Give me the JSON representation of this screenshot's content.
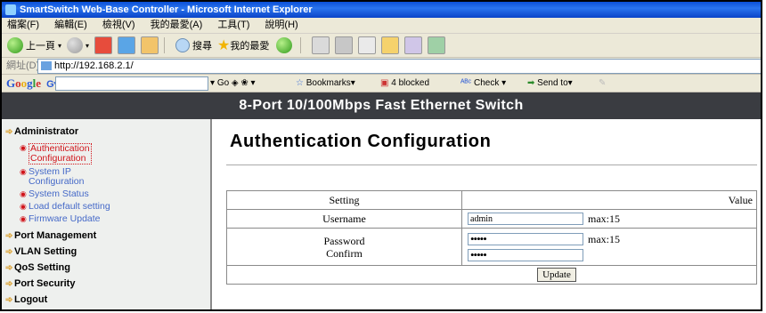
{
  "window": {
    "title": "SmartSwitch Web-Base Controller - Microsoft Internet Explorer"
  },
  "menu": [
    "檔案(F)",
    "編輯(E)",
    "檢視(V)",
    "我的最愛(A)",
    "工具(T)",
    "說明(H)"
  ],
  "toolbar": {
    "back_label": "上一頁",
    "search_label": "搜尋",
    "favorites_label": "我的最愛"
  },
  "address": {
    "label": "網址(D)",
    "url": "http://192.168.2.1/"
  },
  "googlebar": {
    "go_label": "Go",
    "bookmarks_label": "Bookmarks▾",
    "blocked_label": "4 blocked",
    "check_label": "Check ▾",
    "sendto_label": "Send to▾"
  },
  "banner": {
    "title": "8-Port 10/100Mbps Fast Ethernet Switch"
  },
  "sidebar": {
    "header": "Administrator",
    "sub_items": [
      {
        "line1": "Authentication",
        "line2": "Configuration",
        "active": true
      },
      {
        "line1": "System IP",
        "line2": "Configuration"
      },
      {
        "line1": "System Status"
      },
      {
        "line1": "Load default setting"
      },
      {
        "line1": "Firmware Update"
      }
    ],
    "sections": [
      "Port Management",
      "VLAN Setting",
      "QoS Setting",
      "Port Security",
      "Logout"
    ]
  },
  "main": {
    "title": "Authentication Configuration",
    "table": {
      "col_setting": "Setting",
      "col_value": "Value",
      "username_label": "Username",
      "username_value": "admin",
      "username_max": "max:15",
      "password_label": "Password",
      "confirm_label": "Confirm",
      "password_value": "•••••",
      "confirm_value": "•••••",
      "password_max": "max:15",
      "update_label": "Update"
    }
  }
}
